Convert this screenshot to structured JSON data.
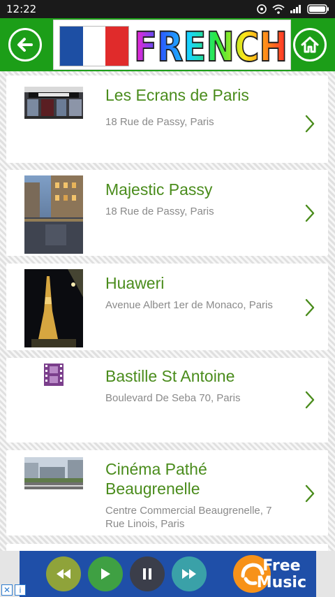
{
  "status_bar": {
    "time": "12:22"
  },
  "header": {
    "banner_word": "FRENCH",
    "back_icon": "arrow-left-icon",
    "home_icon": "home-icon"
  },
  "list": {
    "items": [
      {
        "title": "Les Ecrans de Paris",
        "address": "18 Rue de Passy, Paris",
        "thumbnail": "cinema-storefront"
      },
      {
        "title": "Majestic Passy",
        "address": "18 Rue de Passy, Paris",
        "thumbnail": "paris-street-at-night"
      },
      {
        "title": "Huaweri",
        "address": "Avenue Albert 1er de Monaco, Paris",
        "thumbnail": "eiffel-tower-at-night"
      },
      {
        "title": "Bastille St Antoine",
        "address": "Boulevard De Seba 70, Paris",
        "thumbnail": "film-strip-icon"
      },
      {
        "title": "Cinéma Pathé Beaugrenelle",
        "address": "Centre Commercial Beaugrenelle, 7 Rue Linois, Paris",
        "thumbnail": "mall-building"
      }
    ]
  },
  "ad": {
    "text_line1": "Free",
    "text_line2": "Music",
    "info_label": "i",
    "close_label": "✕"
  },
  "colors": {
    "accent": "#1c9e18",
    "title_text": "#4a8c1c",
    "address_text": "#8a8a8a"
  }
}
